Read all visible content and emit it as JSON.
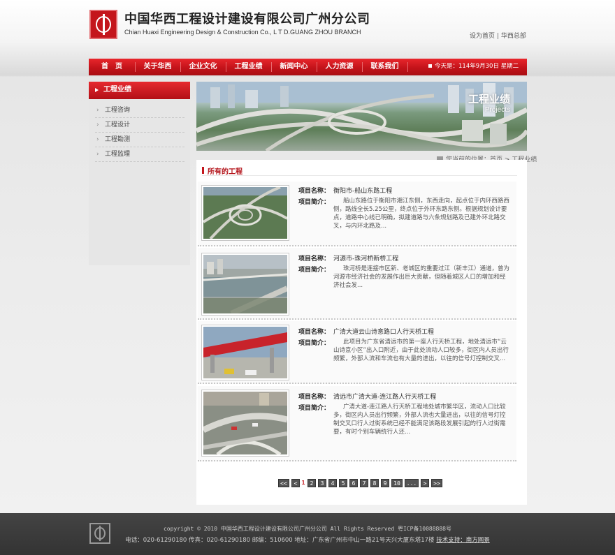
{
  "header": {
    "company_cn": "中国华西工程设计建设有限公司广州分公司",
    "company_en": "Chian Huaxi Engineering Design & Construction Co., L T D.GUANG ZHOU BRANCH",
    "link_home": "设为首页",
    "link_sep": "|",
    "link_hq": "华西总部"
  },
  "nav": {
    "items": [
      "首　页",
      "关于华西",
      "企业文化",
      "工程业绩",
      "新闻中心",
      "人力资源",
      "联系我们"
    ],
    "date": "今天是：114年9月30日 星期二",
    "colors": {
      "primary": "#c4161c"
    }
  },
  "sidebar": {
    "title": "工程业绩",
    "items": [
      "工程咨询",
      "工程设计",
      "工程勘测",
      "工程监理"
    ]
  },
  "banner": {
    "title": "工程业绩",
    "subtitle": "Projects"
  },
  "breadcrumb": {
    "text": "您当前的位置：首页 > 工程业绩"
  },
  "section": {
    "title": "所有的工程"
  },
  "labels": {
    "name": "项目名称：",
    "intro": "项目简介："
  },
  "projects": [
    {
      "name": "衡阳市-船山东路工程",
      "desc": "船山东路位于衡阳市湘江东侧，东西走向，起点位于内环西路西侧，路线全长5.25公里，终点位于外环东路东侧。根据规划设计要点，道路中心线已明确，拟建道路与六条规划路及已建外环北路交叉，与内环北路及..."
    },
    {
      "name": "河源市-珠河桥新桥工程",
      "desc": "珠河桥是连接市区新、老城区的重要过江（新丰江）通道，曾为河源市经济社会的发展作出巨大贡献，但随着城区人口的增加和经济社会发..."
    },
    {
      "name": "广清大道云山诗意路口人行天桥工程",
      "desc": "此项目为广东省清远市的第一座人行天桥工程，地处清远市“云山诗意小区”出入口附近，由于此处流动人口较多，街区内人员出行频繁，外部人流和车流也有大量的进出，以往的信号灯控制交叉..."
    },
    {
      "name": "清远市广清大道-连江路人行天桥工程",
      "desc": "广清大道-连江路人行天桥工程地处城市繁华区，流动人口比较多，街区内人员出行频繁，外部人流也大量进出，以往的信号灯控制交叉口行人过街系统已经不能满足该路段发展引起的行人过街需要，有时个别车辆统行人还..."
    }
  ],
  "pagination": {
    "first": "<<",
    "prev": "<",
    "pages": [
      "1",
      "2",
      "3",
      "4",
      "5",
      "6",
      "7",
      "8",
      "9",
      "10"
    ],
    "current": "1",
    "ellipsis": "...",
    "next": ">",
    "last": ">>"
  },
  "footer": {
    "copyright": "copyright © 2010 中国华西工程设计建设有限公司广州分公司 All Rights Reserved 粤ICP备10088888号",
    "contact": "电话：020-61290180 传真：020-61290180 邮编：510600 地址：广东省广州市中山一路21号天兴大厦东塔17楼",
    "support_label": "技术支持：南方网景"
  }
}
